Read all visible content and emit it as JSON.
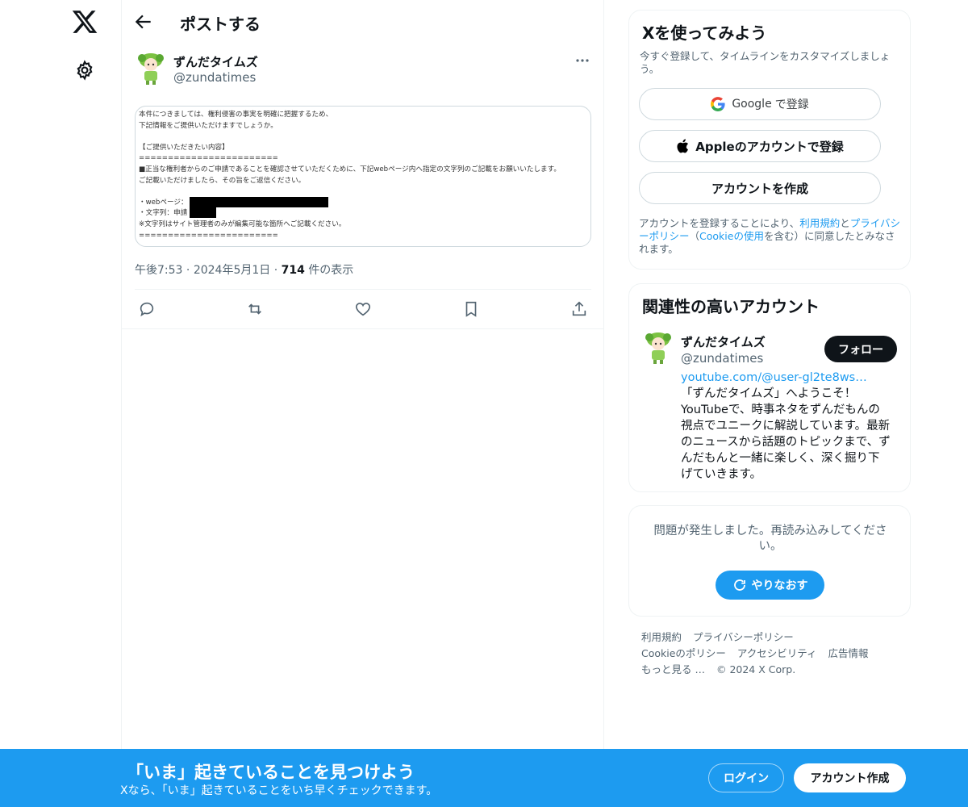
{
  "nav": {
    "logo_icon": "x-logo-icon",
    "settings_icon": "gear-icon"
  },
  "header": {
    "back_icon": "arrow-left-icon",
    "title": "ポストする"
  },
  "post": {
    "author_name": "ずんだタイムズ",
    "author_handle": "@zundatimes",
    "media_lines": [
      "本件につきましては、権利侵害の事実を明確に把握するため、",
      "下記情報をご提供いただけますでしょうか。",
      "",
      "【ご提供いただきたい内容】",
      "========================",
      "■正当な権利者からのご申請であることを確認させていただくために、下記webページ内へ指定の文字列のご記載をお願いいたします。",
      "ご記載いただけましたら、その旨をご返信ください。",
      "",
      "・webページ：",
      "・文字列：申請",
      "※文字列はサイト管理者のみが編集可能な箇所へご記載ください。",
      "========================"
    ],
    "time": "午後7:53",
    "date": "2024年5月1日",
    "views_count": "714",
    "views_label": "件の表示",
    "separator": "·"
  },
  "signup_card": {
    "title": "Xを使ってみよう",
    "subtitle": "今すぐ登録して、タイムラインをカスタマイズしましょう。",
    "google_label": "Google",
    "google_suffix": "で登録",
    "apple_label": "Appleのアカウントで登録",
    "create_label": "アカウントを作成",
    "terms_prefix": "アカウントを登録することにより、",
    "terms_link1": "利用規約",
    "terms_and": "と",
    "terms_link2": "プライバシーポリシー",
    "terms_paren_open": "（",
    "terms_link3": "Cookieの使用",
    "terms_paren_close": "を含む）に同意したとみなされます。"
  },
  "related": {
    "title": "関連性の高いアカウント",
    "name": "ずんだタイムズ",
    "handle": "@zundatimes",
    "follow_label": "フォロー",
    "bio_link": "youtube.com/@user-gl2te8ws…",
    "bio_text": " 「ずんだタイムズ」へようこそ！YouTubeで、時事ネタをずんだもんの視点でユニークに解説しています。最新のニュースから話題のトピックまで、ずんだもんと一緒に楽しく、深く掘り下げていきます。"
  },
  "error_card": {
    "message": "問題が発生しました。再読み込みしてください。",
    "retry_label": "やりなおす"
  },
  "footer": {
    "terms": "利用規約",
    "privacy": "プライバシーポリシー",
    "cookie": "Cookieのポリシー",
    "accessibility": "アクセシビリティ",
    "ads": "広告情報",
    "more": "もっと見る …",
    "copyright": "© 2024 X Corp."
  },
  "bottom_bar": {
    "title": "「いま」起きていることを見つけよう",
    "subtitle": "Xなら、「いま」起きていることをいち早くチェックできます。",
    "login_label": "ログイン",
    "signup_label": "アカウント作成"
  },
  "colors": {
    "accent": "#1d9bf0",
    "text": "#0f1419",
    "muted": "#536471",
    "border": "#eff3f4"
  }
}
